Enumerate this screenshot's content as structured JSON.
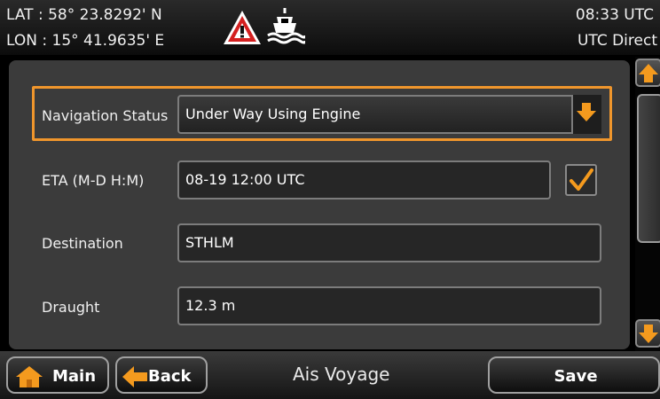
{
  "header": {
    "lat": "LAT : 58° 23.8292' N",
    "lon": "LON : 15° 41.9635' E",
    "time": "08:33 UTC",
    "time_source": "UTC Direct",
    "icons": [
      "warning-triangle-icon",
      "ship-icon"
    ]
  },
  "form": {
    "navigation_status": {
      "label": "Navigation Status",
      "value": "Under Way Using Engine",
      "icon": "chevron-down-icon"
    },
    "eta": {
      "label": "ETA (M-D H:M)",
      "value": "08-19 12:00 UTC",
      "checked": true
    },
    "destination": {
      "label": "Destination",
      "value": "STHLM"
    },
    "draught": {
      "label": "Draught",
      "value": "12.3 m"
    }
  },
  "footer": {
    "main_label": "Main",
    "back_label": "Back",
    "title": "Ais Voyage",
    "save_label": "Save"
  },
  "colors": {
    "accent": "#f0962c",
    "panel": "#3b3b3b",
    "field": "#262626"
  }
}
